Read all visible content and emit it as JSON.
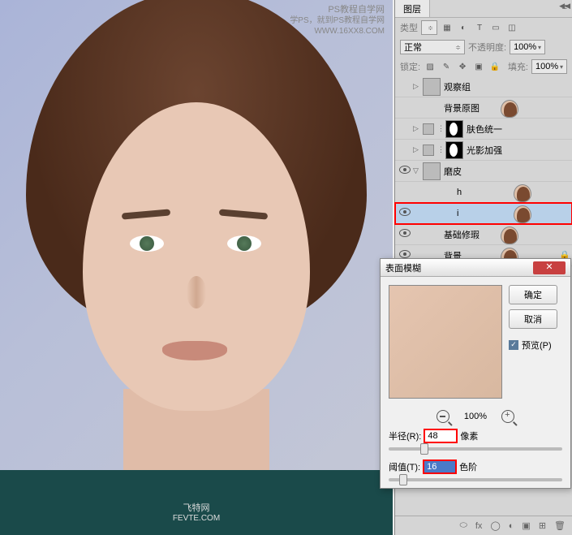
{
  "watermark_top": {
    "line1": "PS教程自学网",
    "line2": "学PS，就到PS教程自学网",
    "line3": "WWW.16XX8.COM"
  },
  "watermark_bottom": {
    "line1": "飞特网",
    "line2": "FEVTE.COM"
  },
  "panel": {
    "tab": "图层",
    "type_label": "类型",
    "blend_mode": "正常",
    "opacity_label": "不透明度:",
    "opacity_value": "100%",
    "lock_label": "锁定:",
    "fill_label": "填充:",
    "fill_value": "100%"
  },
  "layers": [
    {
      "vis": false,
      "name": "观察组",
      "kind": "folder",
      "indent": 0,
      "tw": ">"
    },
    {
      "vis": false,
      "name": "背景原图",
      "kind": "face",
      "indent": 0
    },
    {
      "vis": false,
      "name": "肤色统一",
      "kind": "mask",
      "indent": 0,
      "tw": ">",
      "link": true,
      "extra": true
    },
    {
      "vis": false,
      "name": "光影加强",
      "kind": "mask",
      "indent": 0,
      "tw": ">",
      "link": true,
      "extra": true
    },
    {
      "vis": true,
      "name": "磨皮",
      "kind": "folder",
      "indent": 0,
      "tw": "v"
    },
    {
      "vis": false,
      "name": "h",
      "kind": "face",
      "indent": 1
    },
    {
      "vis": true,
      "name": "i",
      "kind": "face",
      "indent": 1,
      "selected": true,
      "highlight": true
    },
    {
      "vis": true,
      "name": "基础修瑕",
      "kind": "face",
      "indent": 0
    },
    {
      "vis": true,
      "name": "背景",
      "kind": "face",
      "indent": 0,
      "locked": true
    }
  ],
  "dialog": {
    "title": "表面模糊",
    "ok": "确定",
    "cancel": "取消",
    "preview": "预览(P)",
    "zoom": "100%",
    "radius_label": "半径(R):",
    "radius_value": "48",
    "radius_unit": "像素",
    "threshold_label": "阈值(T):",
    "threshold_value": "16",
    "threshold_unit": "色阶"
  }
}
